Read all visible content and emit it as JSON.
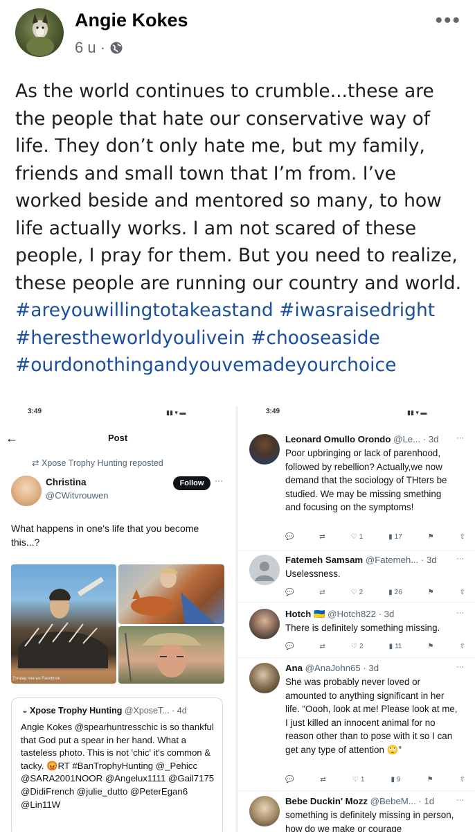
{
  "post": {
    "author": "Angie Kokes",
    "time": "6 u ·",
    "text_plain": "As the world continues to crumble...these are the people that hate our conservative way of life. They don’t only hate me, but my family, friends and small town that I’m from. I’ve worked beside and mentored so many, to how life actually works. I am not scared of these people, I pray for them. But you need to realize, these people are running our country and world.",
    "hashtags": [
      "#areyouwillingtotakeastand",
      "#iwasraisedright",
      "#herestheworldyoulivein",
      "#chooseaside",
      "#ourdonothingandyouvemadeyourchoice"
    ]
  },
  "left_shot": {
    "status_time": "3:49",
    "title": "Post",
    "repost_label": "Xpose Trophy Hunting reposted",
    "user_name": "Christina",
    "user_handle": "@CWitvrouwen",
    "follow_label": "Follow",
    "tweet_text": "What happens in one's life that you become this...?",
    "photo_caption": "Zondag nieuws Facebook",
    "quote_name": "Xpose Trophy Hunting",
    "quote_handle_time": "@XposeT... · 4d",
    "quote_text": "Angie Kokes @spearhuntresschic is so thankful that God put a spear in her hand. What a tasteless photo. This is not 'chic' it's common & tacky. 😡RT #BanTrophyHunting @_Pehicc @SARA2001NOOR @Angelux1111 @Gail7175 @DidiFrench @julie_dutto @PeterEgan6 @Lin11W"
  },
  "right_shot": {
    "status_time": "3:49",
    "replies": [
      {
        "name": "Leonard Omullo Orondo",
        "handle_time": "@Le... · 3d",
        "text": "Poor upbringing or lack of parenhood, followed by rebellion? Actually,we now demand that the sociology of THters be studied. We may be missing smething and focusing on the symptoms!",
        "likes": "1",
        "views": "17",
        "avatar_color": "#3b4a66"
      },
      {
        "name": "Fatemeh Samsam",
        "handle_time": "@Fatemeh... · 3d",
        "text": "Uselessness.",
        "likes": "2",
        "views": "26",
        "avatar_color": "#9aa4ad"
      },
      {
        "name": "Hotch 🇺🇦",
        "handle_time": "@Hotch822 · 3d",
        "text": "There is definitely something missing.",
        "likes": "2",
        "views": "11",
        "avatar_color": "#5d5048"
      },
      {
        "name": "Ana",
        "handle_time": "@AnaJohn65 · 3d",
        "text": "She was probably never loved or amounted to anything significant in her life. “Oooh, look at me! Please look at me, I just killed an innocent animal for no reason other than to pose with it so I can get any type of attention 🙄”",
        "likes": "1",
        "views": "9",
        "avatar_color": "#6b5a44"
      },
      {
        "name": "Bebe Duckin' Mozz",
        "handle_time": "@BebeM... · 1d",
        "text": "something is definitely missing in person, how do we make or courage",
        "avatar_color": "#8a7a62"
      }
    ]
  },
  "colors": {
    "hashtag": "#1a4fa0",
    "secondary_text": "#65676b",
    "x_secondary": "#536471"
  }
}
